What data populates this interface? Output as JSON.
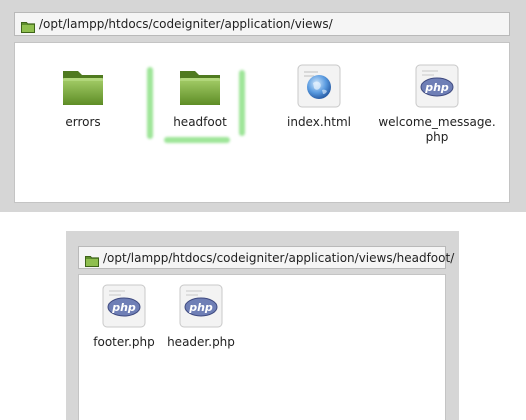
{
  "window_top": {
    "path": "/opt/lampp/htdocs/codeigniter/application/views/",
    "items": [
      {
        "label": "errors",
        "icon": "folder-icon"
      },
      {
        "label": "headfoot",
        "icon": "folder-icon"
      },
      {
        "label": "index.html",
        "icon": "html-file-icon"
      },
      {
        "label": "welcome_message.\nphp",
        "icon": "php-file-icon"
      }
    ],
    "highlight_color": "#7ddc76"
  },
  "window_bottom": {
    "path": "/opt/lampp/htdocs/codeigniter/application/views/headfoot/",
    "items": [
      {
        "label": "footer.php",
        "icon": "php-file-icon"
      },
      {
        "label": "header.php",
        "icon": "php-file-icon"
      }
    ]
  },
  "colors": {
    "folder_green": "#7cab3f",
    "php_badge": "#6f7fb6",
    "frame_gray": "#d6d6d6"
  }
}
